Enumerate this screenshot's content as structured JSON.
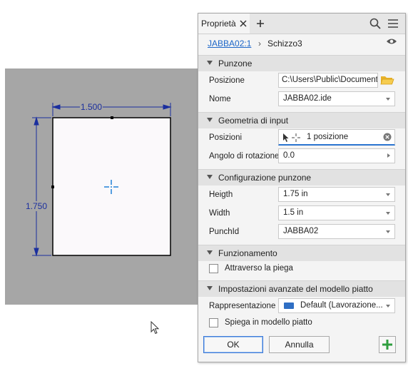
{
  "panel": {
    "tab_label": "Proprietà",
    "breadcrumb": {
      "link": "JABBA02:1",
      "separator": "›",
      "current": "Schizzo3"
    },
    "sections": {
      "punzone": "Punzone",
      "geometria": "Geometria di input",
      "configurazione": "Configurazione punzone",
      "funzionamento": "Funzionamento",
      "avanzate": "Impostazioni avanzate del modello piatto"
    },
    "fields": {
      "posizione_label": "Posizione",
      "posizione_value": "C:\\Users\\Public\\Documents\\",
      "nome_label": "Nome",
      "nome_value": "JABBA02.ide",
      "posizioni_label": "Posizioni",
      "posizioni_value": "1 posizione",
      "angolo_label": "Angolo di rotazione",
      "angolo_value": "0.0",
      "height_label": "Heigth",
      "height_value": "1.75 in",
      "width_label": "Width",
      "width_value": "1.5 in",
      "punchid_label": "PunchId",
      "punchid_value": "JABBA02",
      "attraverso_label": "Attraverso la piega",
      "rappresentazione_label": "Rappresentazione",
      "rappresentazione_value": "Default (Lavorazione...",
      "spiega_label": "Spiega in modello piatto"
    },
    "buttons": {
      "ok": "OK",
      "cancel": "Annulla"
    }
  },
  "sketch": {
    "dim_width": "1.500",
    "dim_height": "1.750"
  },
  "colors": {
    "dimension": "#1b2f9e",
    "center_mark": "#1f7fd6",
    "accent_blue": "#2a74d0",
    "add_green": "#2e9e3e"
  }
}
